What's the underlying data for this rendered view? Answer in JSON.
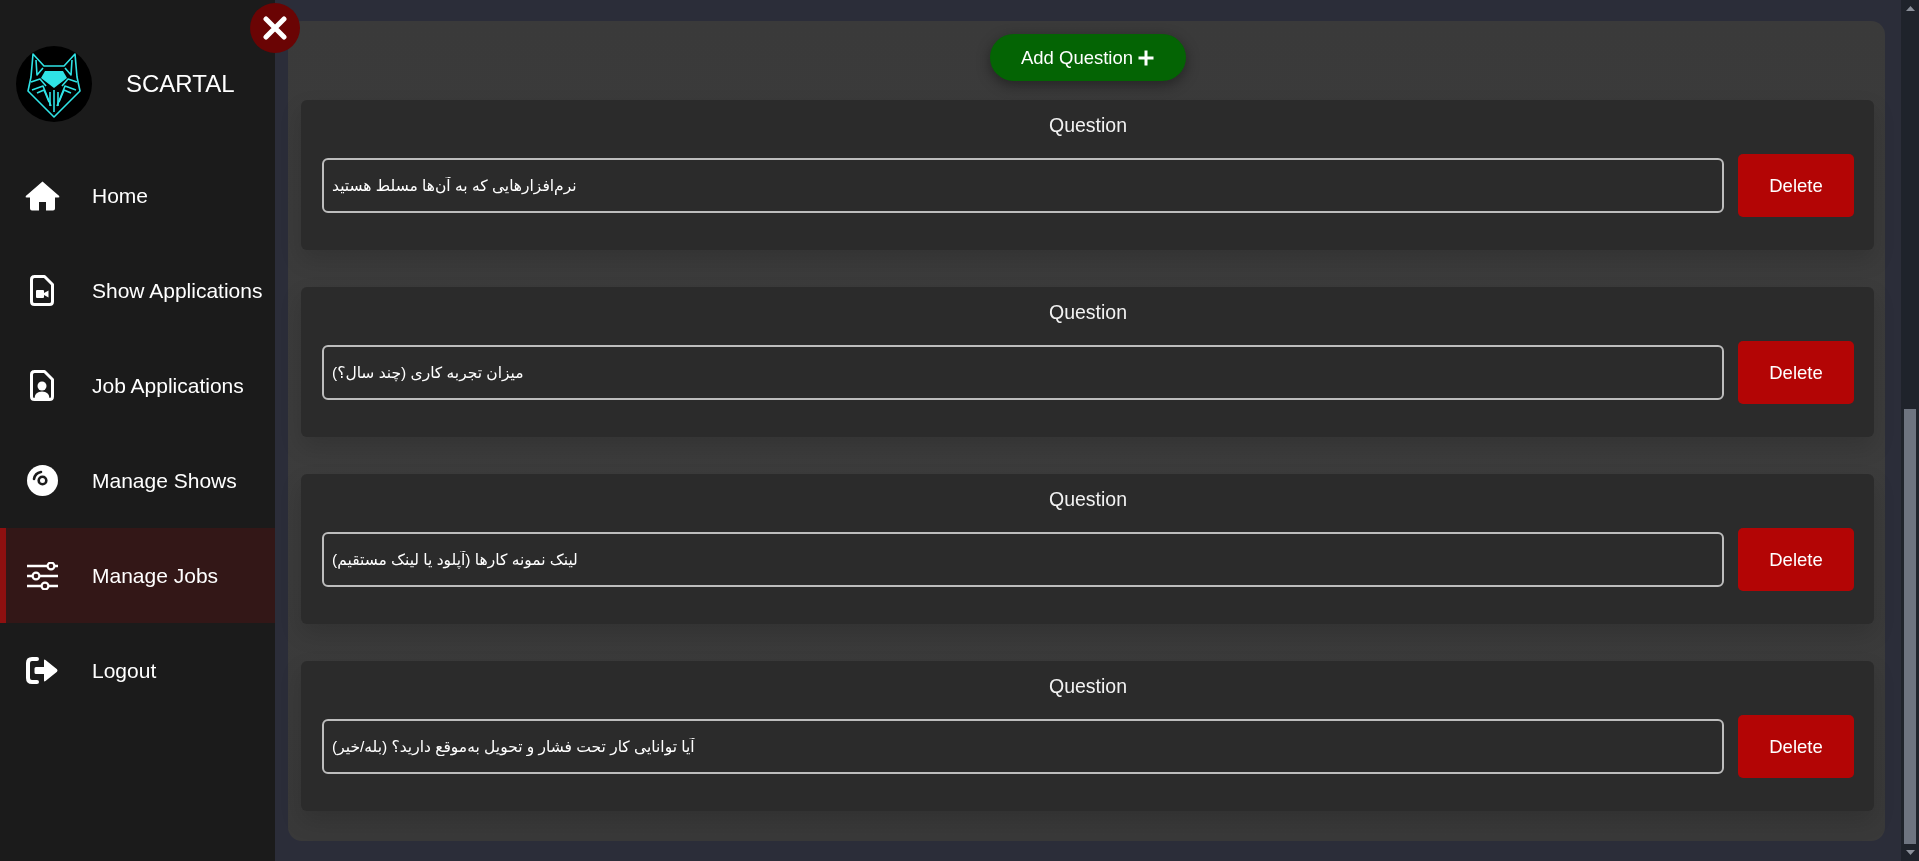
{
  "sidebar": {
    "brand": "SCARTAL",
    "items": [
      {
        "kind": "home",
        "label": "Home",
        "selected": false
      },
      {
        "kind": "video-file",
        "label": "Show Applications",
        "selected": false
      },
      {
        "kind": "person-file",
        "label": "Job Applications",
        "selected": false
      },
      {
        "kind": "disc",
        "label": "Manage Shows",
        "selected": false
      },
      {
        "kind": "sliders",
        "label": "Manage Jobs",
        "selected": true
      },
      {
        "kind": "logout",
        "label": "Logout",
        "selected": false
      }
    ]
  },
  "main": {
    "add_button": "Add Question",
    "questions": [
      {
        "title": "Question",
        "value": "نرم‌افزارهایی که به آن‌ها مسلط هستید",
        "delete_button": "Delete"
      },
      {
        "title": "Question",
        "value": "میزان تجربه کاری (چند سال؟)",
        "delete_button": "Delete"
      },
      {
        "title": "Question",
        "value": "لینک نمونه کارها (آپلود یا لینک مستقیم)",
        "delete_button": "Delete"
      },
      {
        "title": "Question",
        "value": "آیا توانایی کار تحت فشار و تحویل به‌موقع دارید؟ (بله/خیر)",
        "delete_button": "Delete"
      }
    ]
  }
}
